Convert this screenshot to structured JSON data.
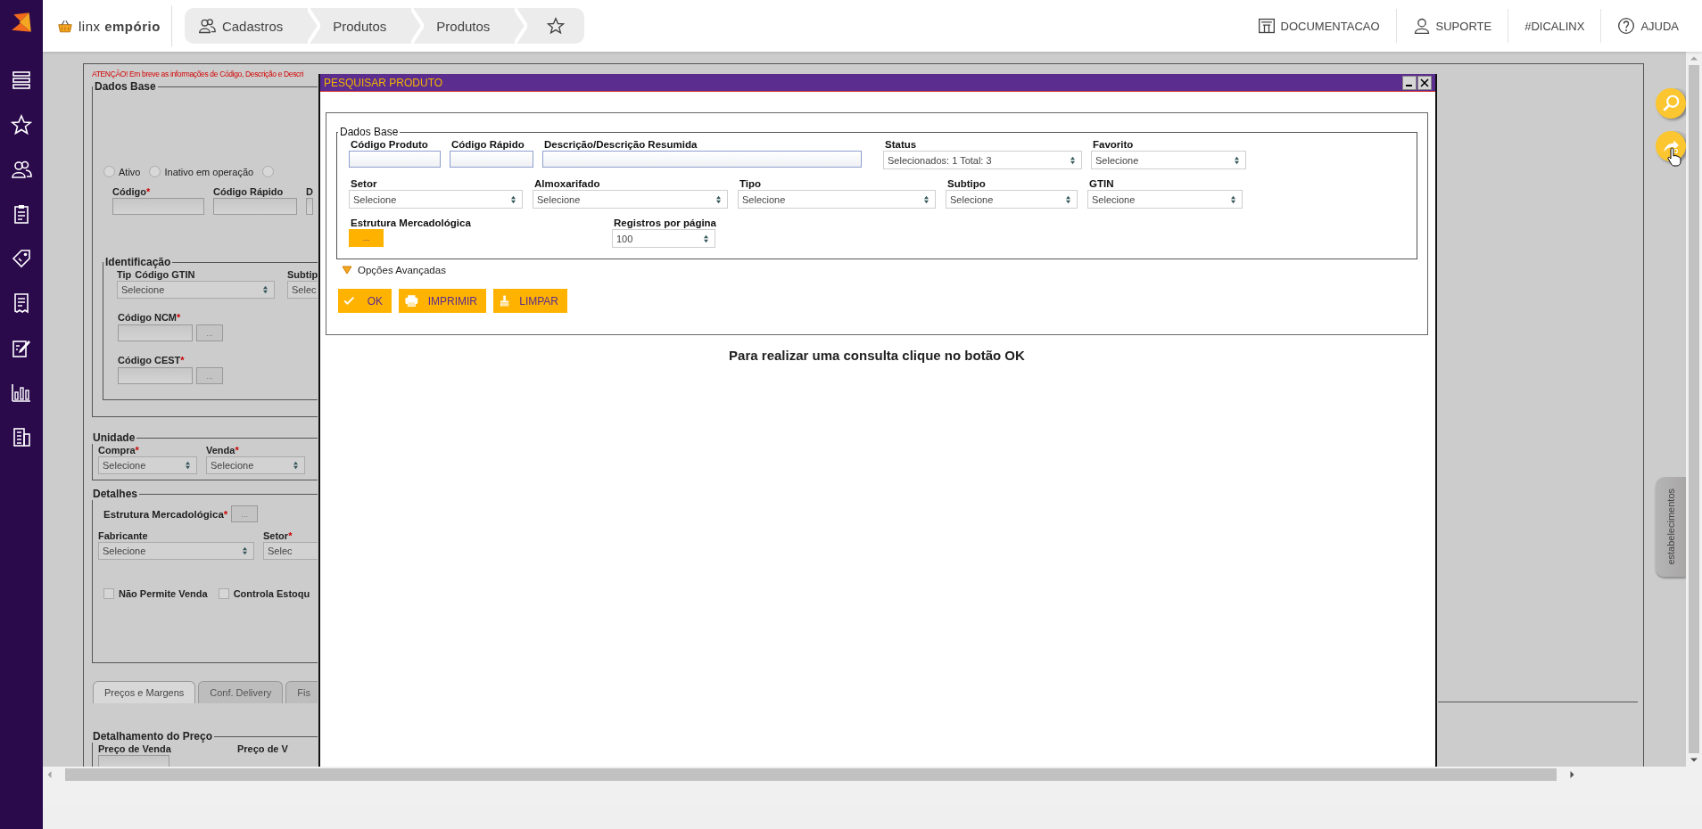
{
  "header": {
    "brand": "linx **empório**",
    "breadcrumb": [
      {
        "label": "Cadastros",
        "kind": "people"
      },
      {
        "label": "Produtos",
        "kind": "plain"
      },
      {
        "label": "Produtos",
        "kind": "plain"
      }
    ],
    "links": [
      {
        "label": "DOCUMENTACAO",
        "kind": "docs"
      },
      {
        "label": "SUPORTE",
        "kind": "support"
      },
      {
        "label": "#DICALINX",
        "kind": "plain"
      },
      {
        "label": "AJUDA",
        "kind": "help"
      }
    ]
  },
  "form": {
    "warning": "ATENÇÃO! Em breve as informações de Código, Descrição e Descri",
    "dados_base": {
      "legend": "Dados Base",
      "radios": [
        {
          "label": "Ativo",
          "selected": false
        },
        {
          "label": "Inativo em operação",
          "selected": false
        },
        {
          "selected": false
        }
      ],
      "fields": [
        {
          "label": "Código",
          "required_mark": "*",
          "kind": "input"
        },
        {
          "label": "Código Rápido",
          "kind": "input"
        },
        {
          "label": "D",
          "kind": "input"
        }
      ]
    },
    "identificacao": {
      "legend": "Identificação",
      "type_row": [
        {
          "label": "Tip",
          "overlay_label": "Código GTIN",
          "kind": "select",
          "value": "Selecione"
        },
        {
          "label": "Subtip",
          "kind": "cut_select",
          "value": "Selec"
        }
      ],
      "lookups": [
        {
          "label": "Código NCM",
          "required_mark": "*",
          "button": "..."
        },
        {
          "label": "Código CEST",
          "required_mark": "*",
          "button": "..."
        }
      ]
    },
    "unidade": {
      "legend": "Unidade",
      "fields": [
        {
          "label": "Compra",
          "required_mark": "*",
          "kind": "select",
          "value": "Selecione"
        },
        {
          "label": "Venda",
          "required_mark": "*",
          "kind": "select",
          "value": "Selecione"
        }
      ]
    },
    "detalhes": {
      "legend": "Detalhes",
      "estrutura": {
        "label": "Estrutura Mercadológica",
        "required_mark": "*",
        "button": "..."
      },
      "fields": [
        {
          "label": "Fabricante",
          "kind": "select",
          "value": "Selecione"
        },
        {
          "label": "Setor",
          "required_mark": "*",
          "kind": "cut_select",
          "value": "Selec"
        }
      ],
      "checkboxes": [
        {
          "label": "Não Permite Venda",
          "checked": false
        },
        {
          "label": "Controla Estoqu",
          "checked": false
        }
      ]
    },
    "tabs": [
      {
        "label": "Preços e Margens",
        "selected": true
      },
      {
        "label": "Conf. Delivery",
        "selected": false
      },
      {
        "label": "Fis",
        "selected": false
      }
    ],
    "preco": {
      "legend": "Detalhamento do Preço",
      "fields": [
        {
          "label": "Preço de Venda"
        },
        {
          "label": "Preço de V"
        }
      ]
    }
  },
  "dialog": {
    "title": "PESQUISAR PRODUTO",
    "legend": "Dados Base",
    "rows": [
      {
        "fields": [
          {
            "label": "Código Produto",
            "kind": "input"
          },
          {
            "label": "Código Rápido",
            "kind": "input"
          },
          {
            "label": "Descrição/Descrição Resumida",
            "kind": "input"
          },
          {
            "label": "Status",
            "kind": "select",
            "value": "Selecionados: 1 Total: 3"
          },
          {
            "label": "Favorito",
            "kind": "select",
            "value": "Selecione"
          }
        ]
      },
      {
        "fields": [
          {
            "label": "Setor",
            "kind": "select",
            "value": "Selecione"
          },
          {
            "label": "Almoxarifado",
            "kind": "select",
            "value": "Selecione"
          },
          {
            "label": "Tipo",
            "kind": "select",
            "value": "Selecione"
          },
          {
            "label": "Subtipo",
            "kind": "select",
            "value": "Selecione"
          },
          {
            "label": "GTIN",
            "kind": "select",
            "value": "Selecione"
          }
        ]
      },
      {
        "fields": [
          {
            "label": "Estrutura Mercadológica",
            "kind": "lookup",
            "value": "..."
          },
          {
            "label": "Registros por página",
            "kind": "select",
            "value": "100"
          }
        ]
      }
    ],
    "advanced": "Opções Avançadas",
    "buttons": [
      {
        "label": "OK",
        "kind": "ok"
      },
      {
        "label": "IMPRIMIR",
        "kind": "print"
      },
      {
        "label": "LIMPAR",
        "kind": "clear"
      }
    ],
    "message": "Para realizar uma consulta clique no botão OK"
  },
  "side_tab": {
    "label": "estabelecimentos"
  }
}
